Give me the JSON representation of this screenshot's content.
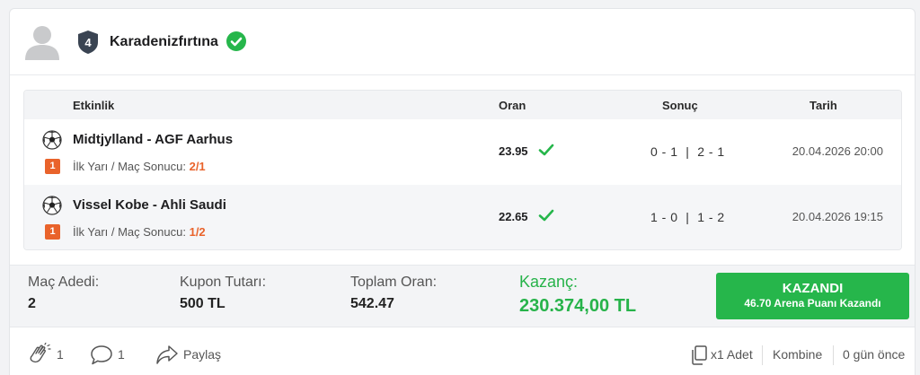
{
  "user": {
    "name": "Karadenizfırtına",
    "rank": "4"
  },
  "table": {
    "headers": {
      "event": "Etkinlik",
      "odd": "Oran",
      "result": "Sonuç",
      "date": "Tarih"
    },
    "rows": [
      {
        "match": "Midtjylland - AGF Aarhus",
        "pick_no": "1",
        "market": "İlk Yarı / Maç Sonucu:",
        "pick": "2/1",
        "odd": "23.95",
        "result": "0 - 1  |  2 - 1",
        "date": "20.04.2026 20:00"
      },
      {
        "match": "Vissel Kobe - Ahli Saudi",
        "pick_no": "1",
        "market": "İlk Yarı / Maç Sonucu:",
        "pick": "1/2",
        "odd": "22.65",
        "result": "1 - 0  |  1 - 2",
        "date": "20.04.2026 19:15"
      }
    ]
  },
  "summary": {
    "match_count_label": "Maç Adedi:",
    "match_count": "2",
    "stake_label": "Kupon Tutarı:",
    "stake": "500 TL",
    "total_odd_label": "Toplam Oran:",
    "total_odd": "542.47",
    "win_label": "Kazanç:",
    "win_amount": "230.374,00 TL",
    "status": "KAZANDI",
    "points": "46.70 Arena Puanı Kazandı"
  },
  "footer": {
    "claps": "1",
    "comments": "1",
    "share": "Paylaş",
    "copies": "x1 Adet",
    "type": "Kombine",
    "time": "0 gün önce"
  },
  "colors": {
    "accent_green": "#26b64b",
    "pick_orange": "#e9632b"
  }
}
